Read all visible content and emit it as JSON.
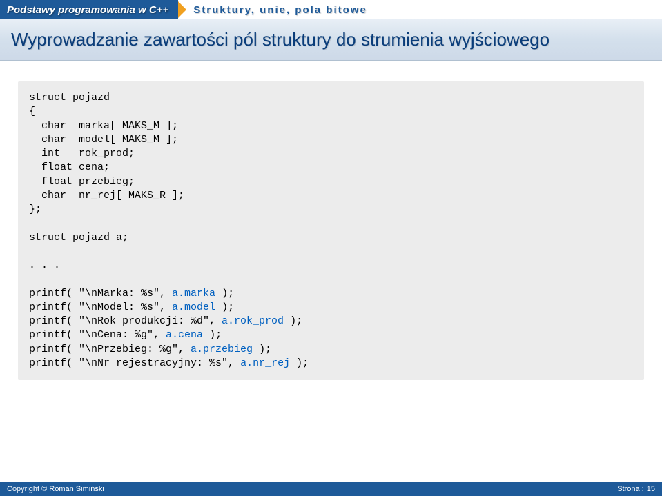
{
  "header": {
    "breadcrumb_left": "Podstawy programowania w C++",
    "breadcrumb_right": "Struktury, unie, pola bitowe"
  },
  "title": "Wyprowadzanie zawartości pól struktury do strumienia wyjściowego",
  "code": {
    "l1": "struct pojazd",
    "l2": "{",
    "l3": "  char  marka[ MAKS_M ];",
    "l4": "  char  model[ MAKS_M ];",
    "l5": "  int   rok_prod;",
    "l6": "  float cena;",
    "l7": "  float przebieg;",
    "l8": "  char  nr_rej[ MAKS_R ];",
    "l9": "};",
    "l10": "",
    "l11": "struct pojazd a;",
    "l12": "",
    "l13": ". . .",
    "l14": "",
    "p1_a": "printf( \"\\nMarka: %s\", ",
    "p1_b": "a.marka",
    "p1_c": " );",
    "p2_a": "printf( \"\\nModel: %s\", ",
    "p2_b": "a.model",
    "p2_c": " );",
    "p3_a": "printf( \"\\nRok produkcji: %d\", ",
    "p3_b": "a.rok_prod",
    "p3_c": " );",
    "p4_a": "printf( \"\\nCena: %g\", ",
    "p4_b": "a.cena",
    "p4_c": " );",
    "p5_a": "printf( \"\\nPrzebieg: %g\", ",
    "p5_b": "a.przebieg",
    "p5_c": " );",
    "p6_a": "printf( \"\\nNr rejestracyjny: %s\", ",
    "p6_b": "a.nr_rej",
    "p6_c": " );"
  },
  "footer": {
    "copyright": "Copyright © Roman Simiński",
    "page_label": "Strona :",
    "page_number": "15"
  }
}
